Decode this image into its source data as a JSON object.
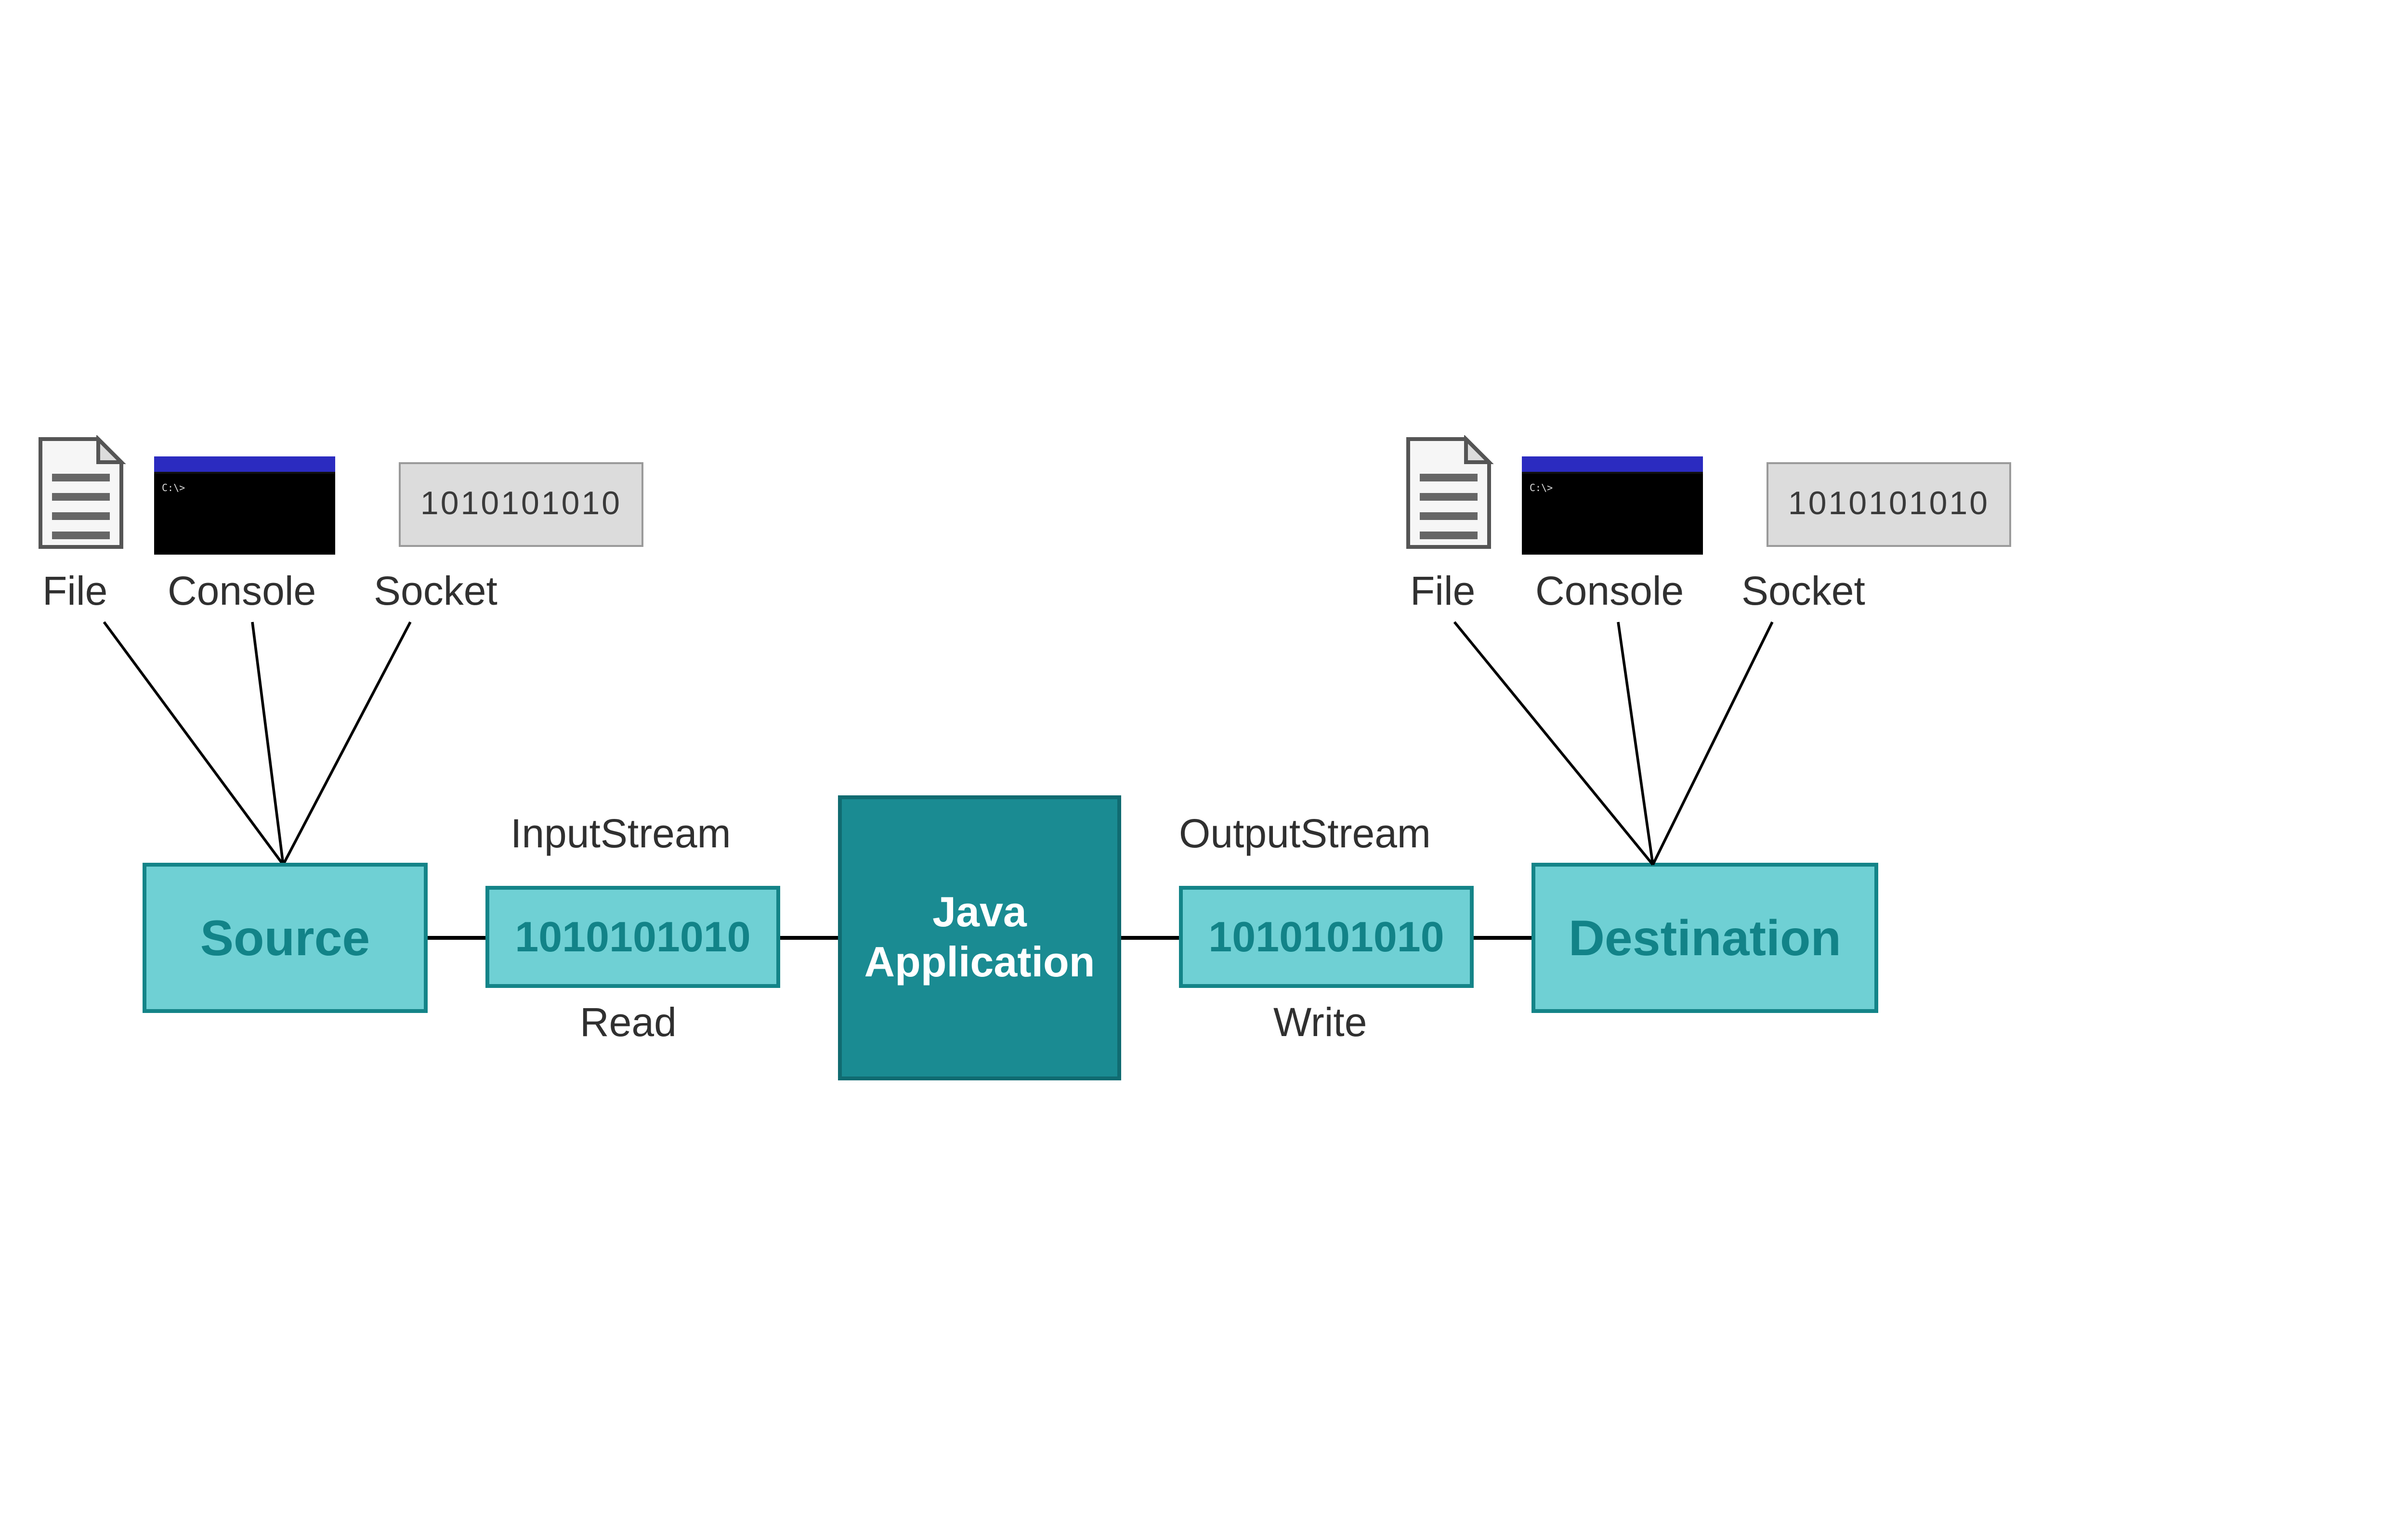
{
  "source": {
    "box_label": "Source",
    "items": [
      {
        "label": "File"
      },
      {
        "label": "Console"
      },
      {
        "label": "Socket",
        "binary": "1010101010"
      }
    ]
  },
  "destination": {
    "box_label": "Destination",
    "items": [
      {
        "label": "File"
      },
      {
        "label": "Console"
      },
      {
        "label": "Socket",
        "binary": "1010101010"
      }
    ]
  },
  "input_stream": {
    "title": "InputStream",
    "binary": "1010101010",
    "action": "Read"
  },
  "output_stream": {
    "title": "OutputStream",
    "binary": "1010101010",
    "action": "Write"
  },
  "center": {
    "line1": "Java",
    "line2": "Application"
  },
  "colors": {
    "light_teal": "#6fd0d4",
    "dark_teal": "#1a8b92",
    "teal_text": "#128388"
  }
}
